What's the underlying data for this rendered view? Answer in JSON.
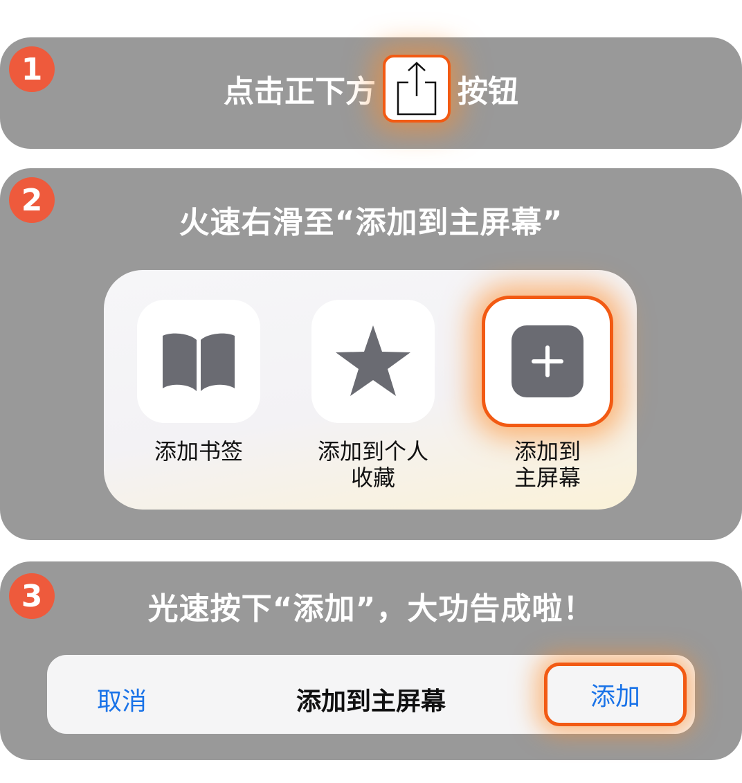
{
  "step1": {
    "number": "1",
    "text_before": "点击正下方",
    "text_after": "按钮",
    "button_icon": "share-icon"
  },
  "step2": {
    "number": "2",
    "title": "火速右滑至“添加到主屏幕”",
    "actions": [
      {
        "label": "添加书签",
        "icon": "book-icon"
      },
      {
        "label": "添加到个人\n收藏",
        "icon": "star-icon"
      },
      {
        "label": "添加到\n主屏幕",
        "icon": "plus-square-icon",
        "highlighted": true
      }
    ]
  },
  "step3": {
    "number": "3",
    "title": "光速按下“添加”，大功告成啦！",
    "bar": {
      "cancel_label": "取消",
      "title": "添加到主屏幕",
      "add_label": "添加"
    }
  },
  "colors": {
    "panel": "#999999",
    "badge": "#ee5a3c",
    "highlight": "#f25a13",
    "link": "#1a73e8",
    "icon_gray": "#6a6b72"
  }
}
